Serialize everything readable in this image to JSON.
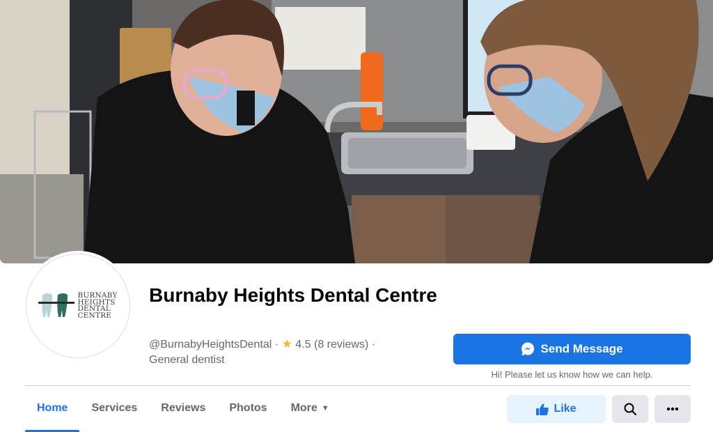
{
  "page": {
    "name": "Burnaby Heights Dental Centre",
    "username": "@BurnabyHeightsDental",
    "rating": "4.5",
    "reviews": "(8 reviews)",
    "category": "General dentist"
  },
  "logo": {
    "line1": "BURNABY",
    "line2": "HEIGHTS",
    "line3": "DENTAL",
    "line4": "CENTRE"
  },
  "actions": {
    "send_message": "Send Message",
    "send_hint": "Hi! Please let us know how we can help.",
    "like": "Like"
  },
  "tabs": [
    {
      "label": "Home",
      "active": true
    },
    {
      "label": "Services",
      "active": false
    },
    {
      "label": "Reviews",
      "active": false
    },
    {
      "label": "Photos",
      "active": false
    },
    {
      "label": "More",
      "active": false
    }
  ],
  "colors": {
    "accent": "#1b74e4",
    "accent_light": "#e7f3ff",
    "star": "#f7b928",
    "secondary_text": "#65676b"
  },
  "icons": [
    "messenger-icon",
    "star-icon",
    "thumbs-up-icon",
    "search-icon",
    "more-dots-icon",
    "caret-down-icon"
  ]
}
